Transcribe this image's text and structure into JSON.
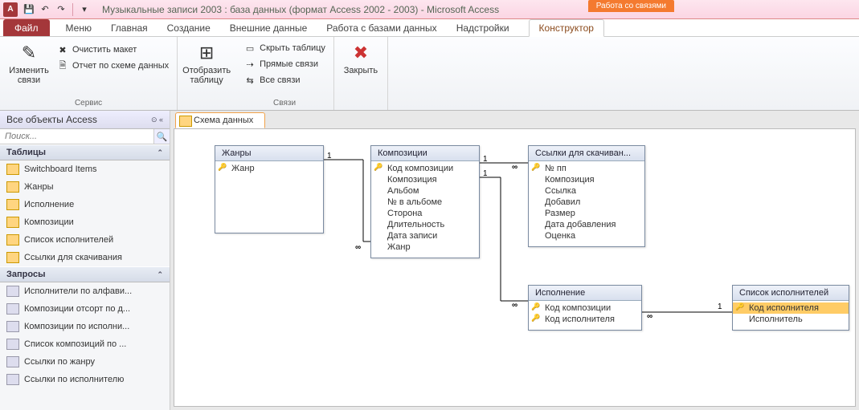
{
  "titlebar": {
    "app_letter": "A",
    "title": "Музыкальные записи 2003 : база данных (формат Access 2002 - 2003)  -  Microsoft Access",
    "context_group": "Работа со связями"
  },
  "tabs": {
    "file": "Файл",
    "items": [
      "Меню",
      "Главная",
      "Создание",
      "Внешние данные",
      "Работа с базами данных",
      "Надстройки"
    ],
    "context": "Конструктор"
  },
  "ribbon": {
    "group1": {
      "label": "Сервис",
      "edit_rel": "Изменить связи",
      "clear_layout": "Очистить макет",
      "rel_report": "Отчет по схеме данных"
    },
    "group2": {
      "show_table": "Отобразить таблицу"
    },
    "group3": {
      "label": "Связи",
      "hide_table": "Скрыть таблицу",
      "direct_rel": "Прямые связи",
      "all_rel": "Все связи"
    },
    "group4": {
      "close": "Закрыть"
    }
  },
  "nav": {
    "header": "Все объекты Access",
    "search_placeholder": "Поиск...",
    "tables_label": "Таблицы",
    "tables": [
      "Switchboard Items",
      "Жанры",
      "Исполнение",
      "Композиции",
      "Список исполнителей",
      "Ссылки для скачивания"
    ],
    "queries_label": "Запросы",
    "queries": [
      "Исполнители по алфави...",
      "Композиции отсорт по д...",
      "Композиции по исполни...",
      "Список композиций  по ...",
      "Ссылки по жанру",
      "Ссылки по исполнителю"
    ]
  },
  "doc_tab": "Схема данных",
  "tables": {
    "genres": {
      "title": "Жанры",
      "fields": [
        {
          "n": "Жанр",
          "k": true
        }
      ]
    },
    "compositions": {
      "title": "Композиции",
      "fields": [
        {
          "n": "Код композиции",
          "k": true
        },
        {
          "n": "Композиция"
        },
        {
          "n": "Альбом"
        },
        {
          "n": "№ в альбоме"
        },
        {
          "n": "Сторона"
        },
        {
          "n": "Длительность"
        },
        {
          "n": "Дата записи"
        },
        {
          "n": "Жанр"
        }
      ]
    },
    "links": {
      "title": "Ссылки для скачиван...",
      "fields": [
        {
          "n": "№ пп",
          "k": true
        },
        {
          "n": "Композиция"
        },
        {
          "n": "Ссылка"
        },
        {
          "n": "Добавил"
        },
        {
          "n": "Размер"
        },
        {
          "n": "Дата добавления"
        },
        {
          "n": "Оценка"
        }
      ]
    },
    "perform": {
      "title": "Исполнение",
      "fields": [
        {
          "n": "Код композиции",
          "k": true
        },
        {
          "n": "Код исполнителя",
          "k": true
        }
      ]
    },
    "artists": {
      "title": "Список исполнителей",
      "fields": [
        {
          "n": "Код исполнителя",
          "k": true,
          "sel": true
        },
        {
          "n": "Исполнитель"
        }
      ]
    }
  },
  "rel_marks": {
    "one": "1",
    "many": "∞"
  }
}
